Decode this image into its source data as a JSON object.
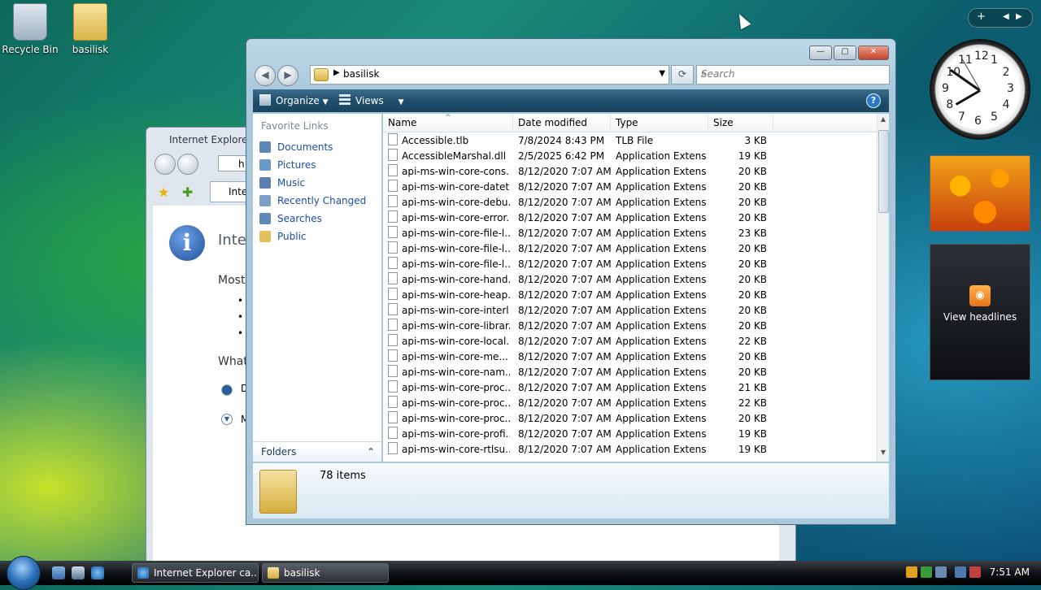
{
  "desktop": {
    "icons": [
      {
        "label": "Recycle Bin"
      },
      {
        "label": "basilisk"
      }
    ]
  },
  "ie_window": {
    "title": "Internet Explorer c",
    "address_partial": "h",
    "tab_partial": "Inter",
    "heading_partial": "Inter",
    "line1": "Most",
    "line2": "What",
    "opt1": "D",
    "opt2": "M"
  },
  "explorer": {
    "address": "basilisk",
    "search_placeholder": "Search",
    "toolbar": {
      "organize": "Organize",
      "views": "Views",
      "help": "?"
    },
    "favorite_links_header": "Favorite Links",
    "favorite_links": [
      "Documents",
      "Pictures",
      "Music",
      "Recently Changed",
      "Searches",
      "Public"
    ],
    "folders_label": "Folders",
    "columns": [
      "Name",
      "Date modified",
      "Type",
      "Size"
    ],
    "rows": [
      [
        "Accessible.tlb",
        "7/8/2024 8:43 PM",
        "TLB File",
        "3 KB"
      ],
      [
        "AccessibleMarshal.dll",
        "2/5/2025 6:42 PM",
        "Application Extens...",
        "19 KB"
      ],
      [
        "api-ms-win-core-cons...",
        "8/12/2020 7:07 AM",
        "Application Extens...",
        "20 KB"
      ],
      [
        "api-ms-win-core-datet...",
        "8/12/2020 7:07 AM",
        "Application Extens...",
        "20 KB"
      ],
      [
        "api-ms-win-core-debu...",
        "8/12/2020 7:07 AM",
        "Application Extens...",
        "20 KB"
      ],
      [
        "api-ms-win-core-error...",
        "8/12/2020 7:07 AM",
        "Application Extens...",
        "20 KB"
      ],
      [
        "api-ms-win-core-file-l...",
        "8/12/2020 7:07 AM",
        "Application Extens...",
        "23 KB"
      ],
      [
        "api-ms-win-core-file-l...",
        "8/12/2020 7:07 AM",
        "Application Extens...",
        "20 KB"
      ],
      [
        "api-ms-win-core-file-l...",
        "8/12/2020 7:07 AM",
        "Application Extens...",
        "20 KB"
      ],
      [
        "api-ms-win-core-hand...",
        "8/12/2020 7:07 AM",
        "Application Extens...",
        "20 KB"
      ],
      [
        "api-ms-win-core-heap...",
        "8/12/2020 7:07 AM",
        "Application Extens...",
        "20 KB"
      ],
      [
        "api-ms-win-core-interl...",
        "8/12/2020 7:07 AM",
        "Application Extens...",
        "20 KB"
      ],
      [
        "api-ms-win-core-librar...",
        "8/12/2020 7:07 AM",
        "Application Extens...",
        "20 KB"
      ],
      [
        "api-ms-win-core-local...",
        "8/12/2020 7:07 AM",
        "Application Extens...",
        "22 KB"
      ],
      [
        "api-ms-win-core-me...",
        "8/12/2020 7:07 AM",
        "Application Extens...",
        "20 KB"
      ],
      [
        "api-ms-win-core-nam...",
        "8/12/2020 7:07 AM",
        "Application Extens...",
        "20 KB"
      ],
      [
        "api-ms-win-core-proc...",
        "8/12/2020 7:07 AM",
        "Application Extens...",
        "21 KB"
      ],
      [
        "api-ms-win-core-proc...",
        "8/12/2020 7:07 AM",
        "Application Extens...",
        "22 KB"
      ],
      [
        "api-ms-win-core-proc...",
        "8/12/2020 7:07 AM",
        "Application Extens...",
        "20 KB"
      ],
      [
        "api-ms-win-core-profi...",
        "8/12/2020 7:07 AM",
        "Application Extens...",
        "19 KB"
      ],
      [
        "api-ms-win-core-rtlsu...",
        "8/12/2020 7:07 AM",
        "Application Extens...",
        "19 KB"
      ]
    ],
    "item_count": "78 items"
  },
  "gadgets": {
    "clock_numbers": [
      "12",
      "1",
      "2",
      "3",
      "4",
      "5",
      "6",
      "7",
      "8",
      "9",
      "10",
      "11"
    ],
    "feed_label": "View headlines"
  },
  "taskbar": {
    "tasks": [
      "Internet Explorer ca...",
      "basilisk"
    ],
    "time": "7:51 AM"
  }
}
